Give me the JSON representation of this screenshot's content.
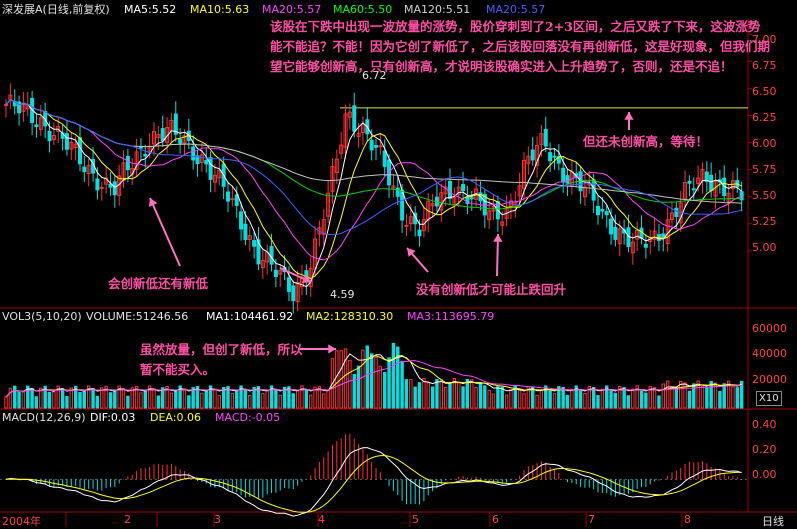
{
  "header": {
    "title": "深发展A",
    "period": "(日线,前复权)",
    "ma_items": [
      {
        "label": "MA5:5.52",
        "color": "#ffffff"
      },
      {
        "label": "MA10:5.63",
        "color": "#ffff00"
      },
      {
        "label": "MA20:5.57",
        "color": "#ff40ff"
      },
      {
        "label": "MA60:5.50",
        "color": "#00ff00"
      },
      {
        "label": "MA120:5.51",
        "color": "#d0d0d0"
      },
      {
        "label": "MA20:5.57",
        "color": "#4060ff"
      }
    ]
  },
  "volume_header": {
    "label": "VOL3(5,10,20)",
    "volume": "VOLUME:51246.56",
    "ma1": "MA1:104461.92",
    "ma2": "MA2:128310.30",
    "ma3": "MA3:113695.79"
  },
  "macd_header": {
    "label": "MACD(12,26,9)",
    "dif": "DIF:0.03",
    "dea": "DEA:0.06",
    "macd": "MACD:-0.05"
  },
  "annotations": {
    "top_text": "该股在下跌中出现一波放量的涨势，股价穿刺到了2+3区间，之后又跌了下来，这波涨势能不能追？不能！因为它创了新低了，之后该股回落没有再创新低，这是好现象，但我们期望它能够创新高，只有创新高，才说明该股确实进入上升趋势了，否则，还是不追！",
    "new_low": "会创新低还有新低",
    "no_new_low": "没有创新低才可能止跌回升",
    "not_new_high": "但还未创新高，等待！",
    "volume_note": "虽然放量，但创了新低，所以暂不能买入。",
    "low_price": "4.59",
    "high_price": "6.72"
  },
  "axis": {
    "price_ticks": [
      "7.00",
      "6.75",
      "6.50",
      "6.25",
      "6.00",
      "5.75",
      "5.50",
      "5.25",
      "5.00"
    ],
    "volume_ticks": [
      "60000",
      "40000",
      "20000"
    ],
    "volume_unit": "X10",
    "macd_ticks": [
      "0.40",
      "0.20",
      "0.00"
    ],
    "x_labels": [
      "2004年",
      "2",
      "3",
      "4",
      "5",
      "6",
      "7",
      "8"
    ],
    "period_label": "日线"
  },
  "chart_data": {
    "type": "line",
    "title": "深发展A (日线,前复权)",
    "x": [
      "2004年",
      "2",
      "3",
      "4",
      "5",
      "6",
      "7",
      "8"
    ],
    "price_ylim": [
      4.5,
      7.15
    ],
    "price_low": 4.59,
    "price_high": 6.72,
    "price_path": [
      6.35,
      6.28,
      6.2,
      6.05,
      5.85,
      5.7,
      5.55,
      5.8,
      6.05,
      6.1,
      6.0,
      5.85,
      5.6,
      5.3,
      5.0,
      4.8,
      4.62,
      4.9,
      5.5,
      6.3,
      6.1,
      5.8,
      5.4,
      5.2,
      5.45,
      5.6,
      5.5,
      5.3,
      5.4,
      5.8,
      6.0,
      5.75,
      5.6,
      5.4,
      5.2,
      5.05,
      5.1,
      5.3,
      5.55,
      5.7,
      5.6,
      5.5
    ],
    "volume_ylim": [
      0,
      70000
    ],
    "volume_ma_last": {
      "ma1": 104461.92,
      "ma2": 128310.3,
      "ma3": 113695.79
    },
    "macd_ylim": [
      -0.25,
      0.5
    ],
    "macd_last": {
      "dif": 0.03,
      "dea": 0.06,
      "macd": -0.05
    }
  }
}
